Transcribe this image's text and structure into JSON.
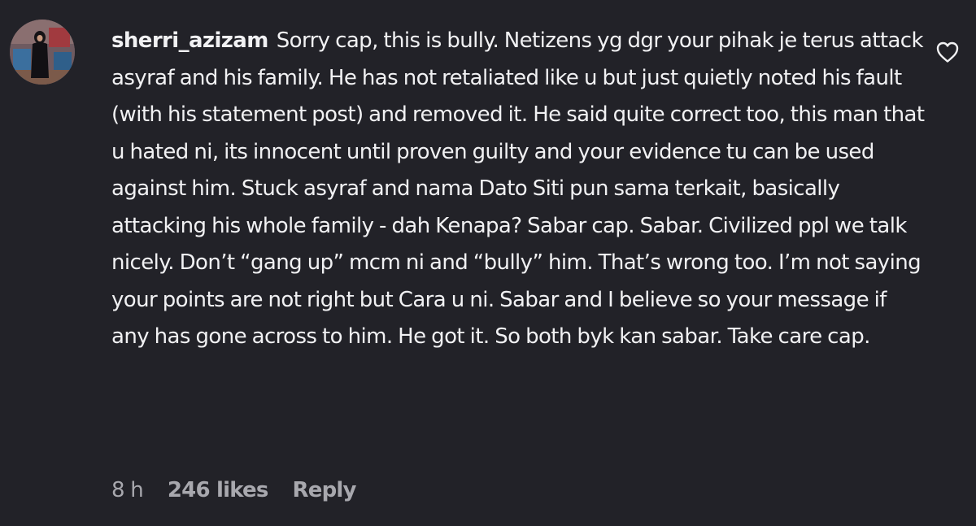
{
  "comment": {
    "username": "sherri_azizam",
    "text": "Sorry cap, this is bully. Netizens yg dgr your pihak je terus attack asyraf and his family. He has not retaliated like u but just quietly noted his fault (with his statement post) and removed it. He said quite correct too, this man that u hated ni, its innocent until proven guilty and your evidence tu can be used against him. Stuck asyraf and nama Dato Siti pun sama terkait, basically attacking his whole family - dah Kenapa? Sabar cap. Sabar. Civilized ppl we talk nicely. Don’t “gang up” mcm ni and “bully” him. That’s wrong too. I’m not saying your points are not right but Cara u ni. Sabar and I believe so your message if any has gone across to him. He got it. So both byk kan sabar. Take care cap.",
    "time": "8 h",
    "likes": "246 likes",
    "reply_label": "Reply",
    "like_icon": "heart-outline-icon"
  },
  "colors": {
    "background": "#222228",
    "text": "#f1f1f3",
    "meta_text": "#a8a8ae"
  }
}
